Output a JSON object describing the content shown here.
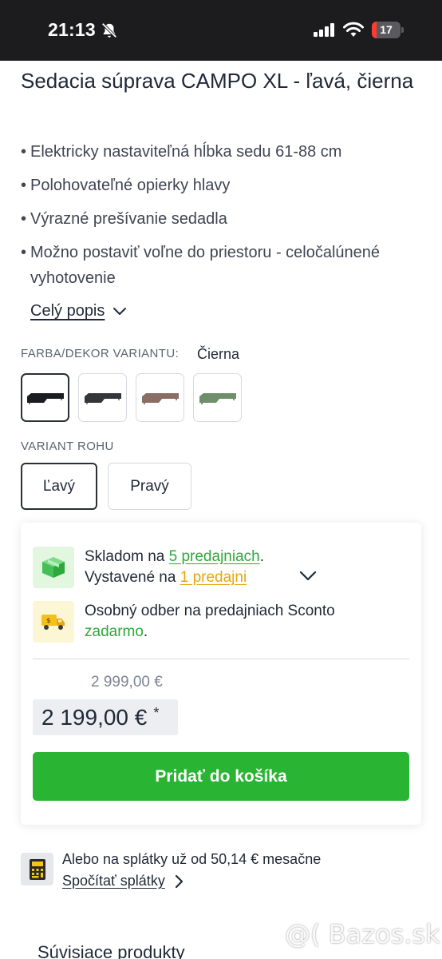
{
  "status_bar": {
    "time": "21:13",
    "battery_level": "17",
    "battery_fraction": 0.17,
    "icons": [
      "bell-slash-icon",
      "cellular-signal-icon",
      "wifi-icon",
      "battery-icon"
    ]
  },
  "product": {
    "title": "Sedacia súprava CAMPO XL - ľavá, čierna",
    "features": [
      "Elektricky nastaviteľná hĺbka sedu 61-88 cm",
      "Polohovateľné opierky hlavy",
      "Výrazné prešívanie sedadla",
      "Možno postaviť voľne do priestoru - celočalúnené vyhotovenie"
    ],
    "full_description_label": "Celý popis"
  },
  "color_variant": {
    "label": "FARBA/DEKOR VARIANTU:",
    "selected": "Čierna",
    "swatches": [
      {
        "color": "#1b1c1f",
        "selected": true
      },
      {
        "color": "#35363a",
        "selected": false
      },
      {
        "color": "#8a6d63",
        "selected": false
      },
      {
        "color": "#6f8f6a",
        "selected": false
      }
    ]
  },
  "corner_variant": {
    "label": "VARIANT ROHU",
    "options": [
      "Ľavý",
      "Pravý"
    ],
    "selected": "Ľavý"
  },
  "availability": {
    "stock_prefix": "Skladom na ",
    "stock_link": "5 predajniach",
    "stock_suffix": ".",
    "display_prefix": "Vystavené na ",
    "display_link": "1 predajni",
    "pickup_text": "Osobný odber na predajniach Sconto ",
    "pickup_highlight": "zadarmo",
    "pickup_suffix": "."
  },
  "pricing": {
    "old_price": "2 999,00 €",
    "price": "2 199,00 €",
    "asterisk": "*",
    "add_to_cart_label": "Pridať do košíka"
  },
  "installment": {
    "text": "Alebo na splátky už od 50,14 € mesačne",
    "link_label": "Spočítať splátky"
  },
  "related": {
    "heading": "Súvisiace produkty"
  },
  "watermark": "@( Bazos.sk",
  "colors": {
    "primary_green": "#29b533",
    "link_green": "#2ea83a",
    "link_orange": "#e7a40f"
  }
}
